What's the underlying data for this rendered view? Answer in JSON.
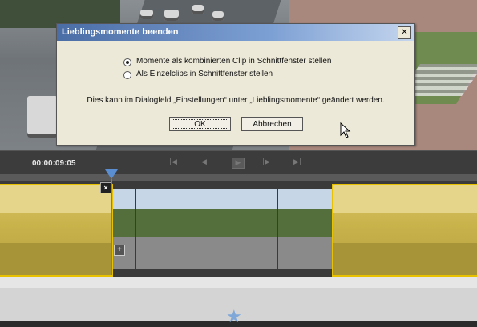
{
  "dialog": {
    "title": "Lieblingsmomente beenden",
    "close_glyph": "✕",
    "option1": "Momente als kombinierten Clip in Schnittfenster stellen",
    "option2": "Als Einzelclips in Schnittfenster stellen",
    "selected_option": 1,
    "info_text": "Dies kann im Dialogfeld „Einstellungen“ unter „Lieblingsmomente“ geändert werden.",
    "ok_label": "OK",
    "cancel_label": "Abbrechen"
  },
  "player": {
    "timecode": "00:00:09:05",
    "controls": [
      "skip-to-start-icon",
      "step-back-icon",
      "play-icon",
      "step-forward-icon",
      "skip-to-end-icon"
    ]
  },
  "timeline": {
    "clip_close_glyph": "×",
    "add_glyph": "+",
    "highlight_color": "#e8c200",
    "playhead_color": "#4f86d9"
  },
  "icons": {
    "star_glyph": "★"
  }
}
